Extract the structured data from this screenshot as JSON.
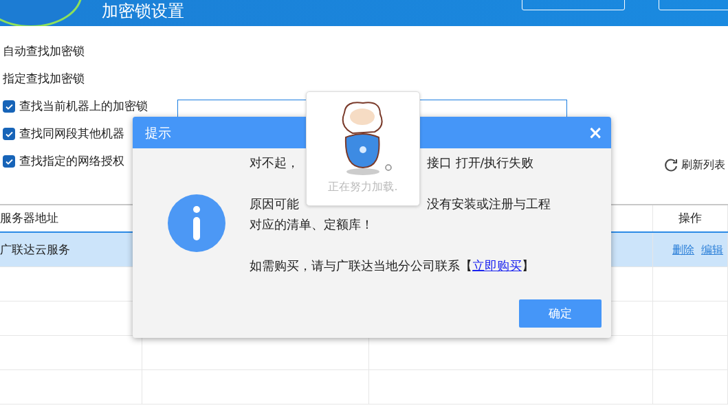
{
  "header": {
    "title": "加密锁设置"
  },
  "options": [
    {
      "kind": "text",
      "label": "自动查找加密锁"
    },
    {
      "kind": "text",
      "label": "指定查找加密锁"
    },
    {
      "kind": "checkbox",
      "label": "查找当前机器上的加密锁",
      "checked": true
    },
    {
      "kind": "checkbox",
      "label": "查找同网段其他机器",
      "checked": true
    },
    {
      "kind": "checkbox",
      "label": "查找指定的网络授权",
      "checked": true
    }
  ],
  "refresh": {
    "label": "刷新列表"
  },
  "table": {
    "columns": [
      "服务器地址",
      "",
      "",
      "操作"
    ],
    "rows": [
      {
        "selected": true,
        "server": "广联达云服务",
        "actions": [
          "删除",
          "编辑"
        ]
      }
    ]
  },
  "dialog": {
    "title": "提示",
    "close": "×",
    "line1": [
      "对不起，",
      "接口 打开/执行失败"
    ],
    "line2": [
      "原因可能",
      "没有安装或注册与工程"
    ],
    "line3": "对应的清单、定额库！",
    "line4": "如需购买，请与广联达当地分公司联系【",
    "link": "立即购买",
    "line4_end": "】",
    "ok": "确定"
  },
  "loading": {
    "text": "正在努力加载."
  }
}
